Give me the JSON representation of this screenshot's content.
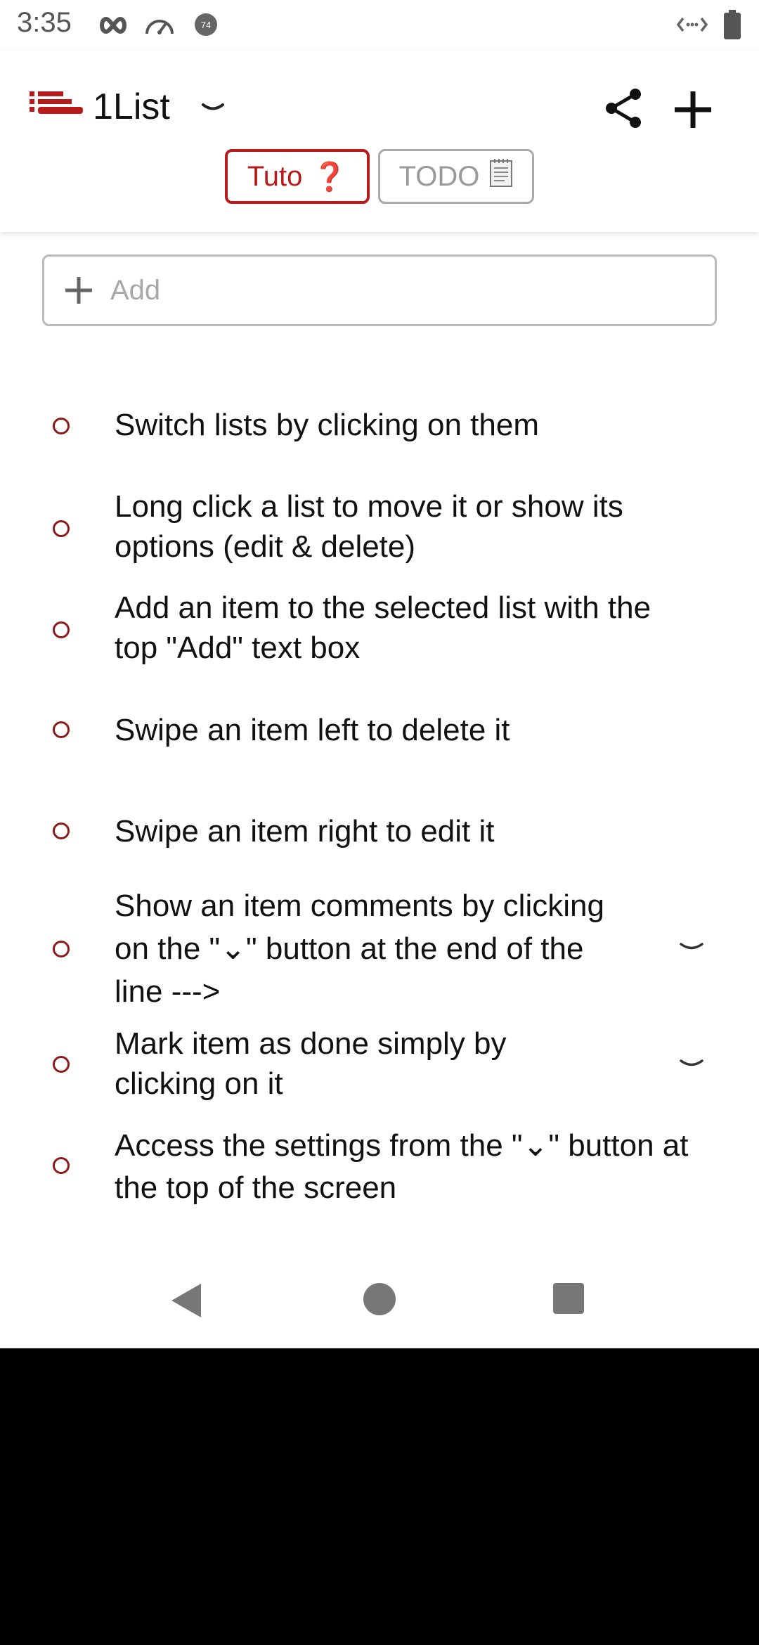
{
  "status_bar": {
    "time": "3:35",
    "icons": [
      "infinity-icon",
      "speedometer-icon",
      "notification-badge-icon",
      "data-transfer-icon",
      "battery-icon"
    ],
    "badge_number": "74"
  },
  "app_bar": {
    "title": "1List",
    "logo_icon": "list-logo-icon",
    "actions": [
      "share-icon",
      "plus-icon"
    ],
    "accent_color": "#b71c1c"
  },
  "list_chips": [
    {
      "label": "Tuto",
      "glyph": "❓",
      "selected": true
    },
    {
      "label": "TODO",
      "glyph": "🗒",
      "selected": false
    }
  ],
  "add_field": {
    "placeholder": "Add",
    "value": ""
  },
  "items": [
    {
      "text": "Switch lists by clicking on them",
      "has_comments": false
    },
    {
      "text": "Long click a list to move it or show its options (edit & delete)",
      "has_comments": false
    },
    {
      "text": "Add an item to the selected list with the top \"Add\" text box",
      "has_comments": false
    },
    {
      "text": "Swipe an item left to delete it",
      "has_comments": false
    },
    {
      "text": "Swipe an item right to edit it",
      "has_comments": false
    },
    {
      "text": "Show an item comments by clicking on the \"⌄\" button at the end of the line --->",
      "has_comments": true
    },
    {
      "text": "Mark item as done simply by clicking on it",
      "has_comments": true
    },
    {
      "text": "Access the settings from the \"⌄\" button at the top of the screen",
      "has_comments": false
    }
  ],
  "nav_bar": {
    "buttons": [
      "back-icon",
      "home-icon",
      "recents-icon"
    ]
  }
}
